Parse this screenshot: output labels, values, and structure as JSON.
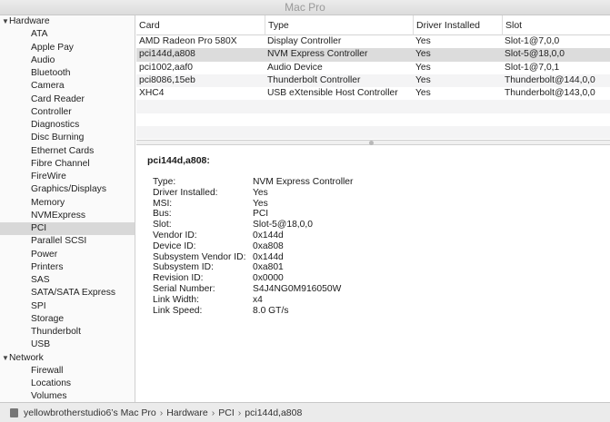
{
  "window": {
    "title": "Mac Pro"
  },
  "sidebar": {
    "groups": [
      {
        "label": "Hardware",
        "items": [
          "ATA",
          "Apple Pay",
          "Audio",
          "Bluetooth",
          "Camera",
          "Card Reader",
          "Controller",
          "Diagnostics",
          "Disc Burning",
          "Ethernet Cards",
          "Fibre Channel",
          "FireWire",
          "Graphics/Displays",
          "Memory",
          "NVMExpress",
          "PCI",
          "Parallel SCSI",
          "Power",
          "Printers",
          "SAS",
          "SATA/SATA Express",
          "SPI",
          "Storage",
          "Thunderbolt",
          "USB"
        ]
      },
      {
        "label": "Network",
        "items": [
          "Firewall",
          "Locations",
          "Volumes"
        ]
      }
    ],
    "selected": "PCI"
  },
  "table": {
    "columns": [
      "Card",
      "Type",
      "Driver Installed",
      "Slot"
    ],
    "rows": [
      [
        "AMD Radeon Pro 580X",
        "Display Controller",
        "Yes",
        "Slot-1@7,0,0"
      ],
      [
        "pci144d,a808",
        "NVM Express Controller",
        "Yes",
        "Slot-5@18,0,0"
      ],
      [
        "pci1002,aaf0",
        "Audio Device",
        "Yes",
        "Slot-1@7,0,1"
      ],
      [
        "pci8086,15eb",
        "Thunderbolt Controller",
        "Yes",
        "Thunderbolt@144,0,0"
      ],
      [
        "XHC4",
        "USB eXtensible Host Controller",
        "Yes",
        "Thunderbolt@143,0,0"
      ]
    ],
    "selected_row": 1
  },
  "detail": {
    "title": "pci144d,a808:",
    "fields": [
      [
        "Type:",
        "NVM Express Controller"
      ],
      [
        "Driver Installed:",
        "Yes"
      ],
      [
        "MSI:",
        "Yes"
      ],
      [
        "Bus:",
        "PCI"
      ],
      [
        "Slot:",
        "Slot-5@18,0,0"
      ],
      [
        "Vendor ID:",
        "0x144d"
      ],
      [
        "Device ID:",
        "0xa808"
      ],
      [
        "Subsystem Vendor ID:",
        "0x144d"
      ],
      [
        "Subsystem ID:",
        "0xa801"
      ],
      [
        "Revision ID:",
        "0x0000"
      ],
      [
        "Serial Number:",
        "S4J4NG0M916050W"
      ],
      [
        "Link Width:",
        "x4"
      ],
      [
        "Link Speed:",
        "8.0 GT/s"
      ]
    ]
  },
  "statusbar": {
    "breadcrumbs": [
      "yellowbrotherstudio6’s Mac Pro",
      "Hardware",
      "PCI",
      "pci144d,a808"
    ],
    "separator": "›"
  }
}
